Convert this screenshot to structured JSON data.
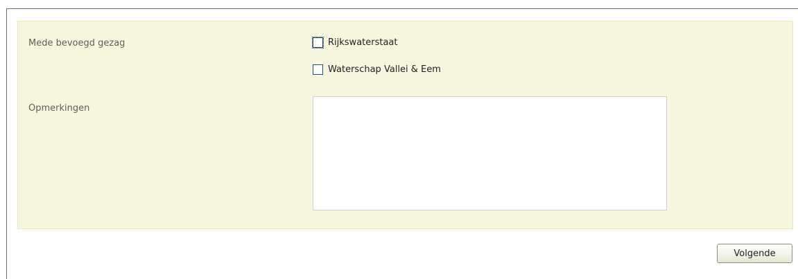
{
  "form": {
    "authority_label": "Mede bevoegd gezag",
    "authority_options": [
      {
        "label": "Rijkswaterstaat",
        "checked": false,
        "focused": true
      },
      {
        "label": "Waterschap Vallei & Eem",
        "checked": false,
        "focused": false
      }
    ],
    "remarks_label": "Opmerkingen",
    "remarks_value": ""
  },
  "actions": {
    "next_label": "Volgende"
  }
}
